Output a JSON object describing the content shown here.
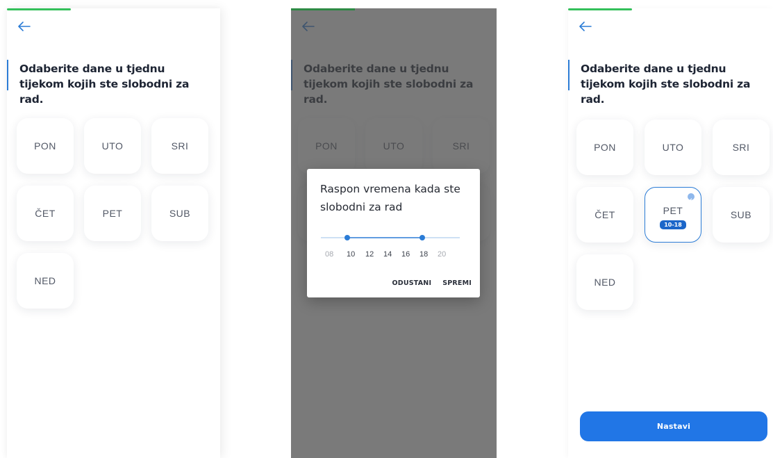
{
  "colors": {
    "accent": "#2176e6",
    "progress": "#33c05a",
    "selected_border": "#2b7cd6"
  },
  "question": "Odaberite dane u tjednu tijekom kojih ste slobodni za rad.",
  "days": [
    "PON",
    "UTO",
    "SRI",
    "ČET",
    "PET",
    "SUB",
    "NED"
  ],
  "icons": {
    "back": "arrow-left-icon",
    "check": "check-circle-icon"
  },
  "dialog": {
    "title": "Raspon vremena kada ste slobodni za rad",
    "ticks": [
      "08",
      "10",
      "12",
      "14",
      "16",
      "18",
      "20"
    ],
    "range_start": "10",
    "range_end": "18",
    "cancel_label": "ODUSTANI",
    "save_label": "SPREMI"
  },
  "selection": {
    "day": "PET",
    "range_label": "10-18"
  },
  "cta_label": "Nastavi"
}
